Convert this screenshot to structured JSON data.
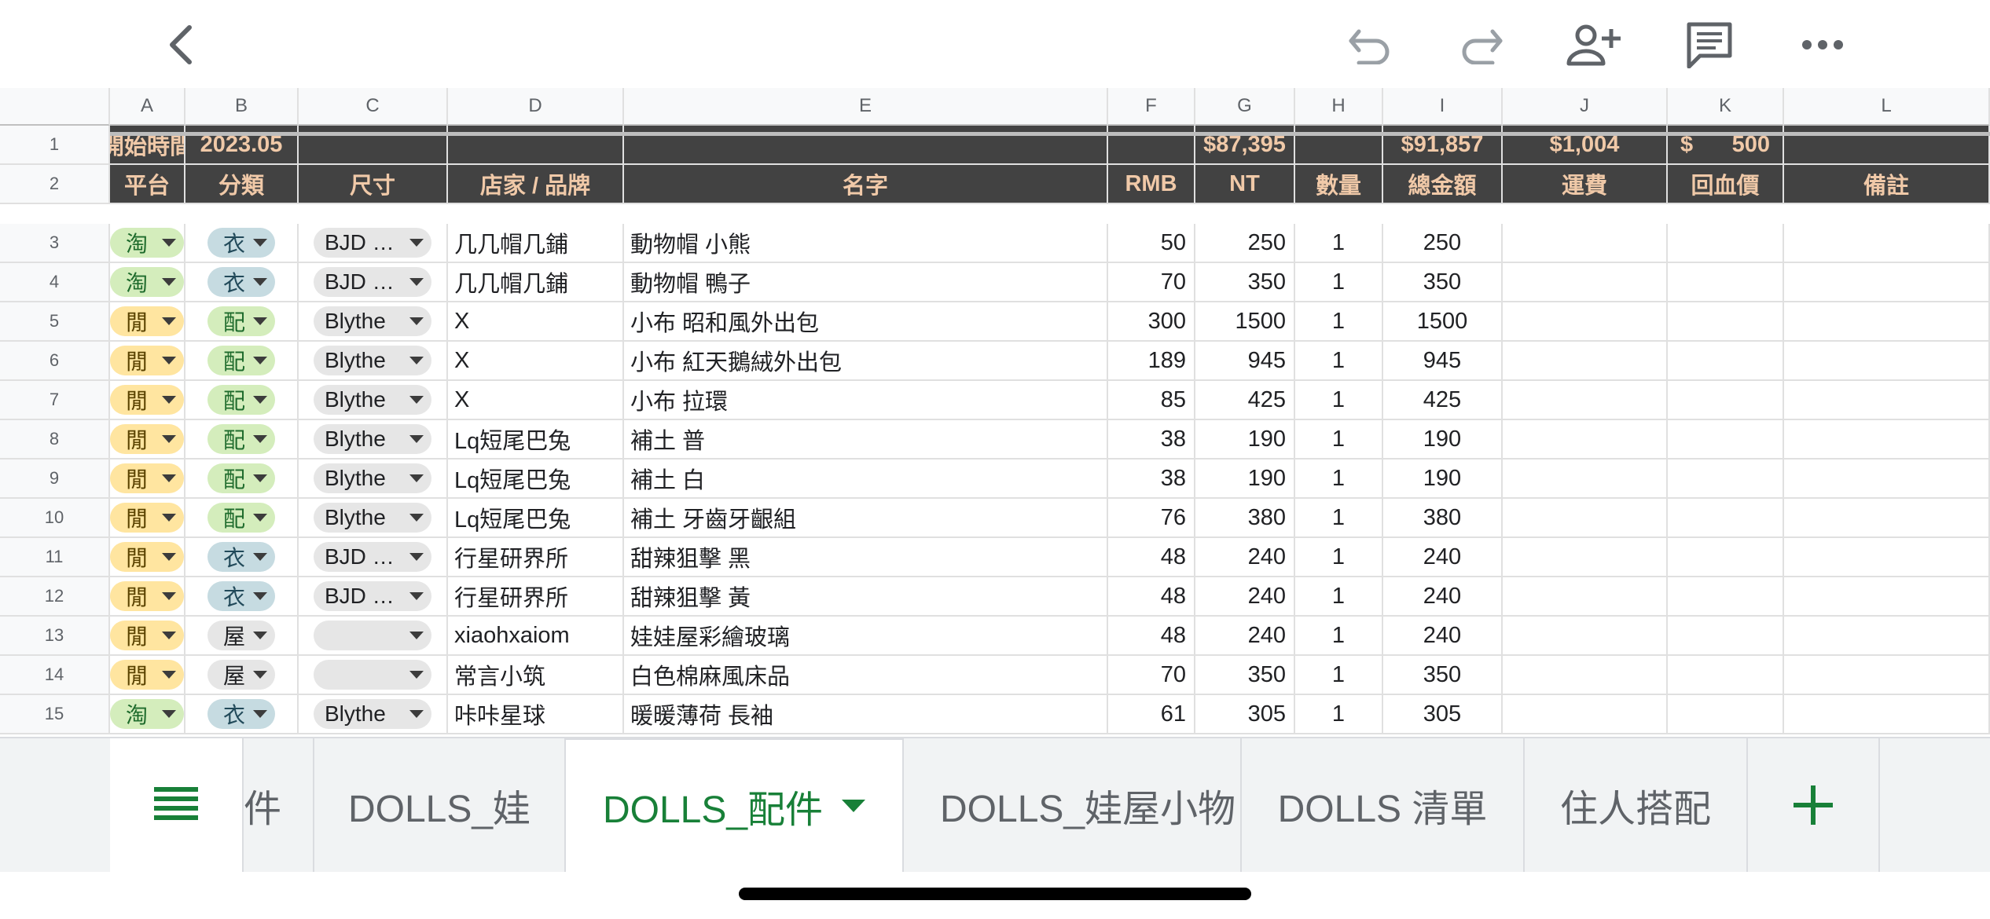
{
  "columns": [
    "A",
    "B",
    "C",
    "D",
    "E",
    "F",
    "G",
    "H",
    "I",
    "J",
    "K",
    "L"
  ],
  "row1": {
    "A": "開始時間",
    "B": "2023.05",
    "G": "$87,395",
    "I": "$91,857",
    "J": "$1,004",
    "K_symbol": "$",
    "K_value": "500"
  },
  "row2": {
    "A": "平台",
    "B": "分類",
    "C": "尺寸",
    "D": "店家 / 品牌",
    "E": "名字",
    "F": "RMB",
    "G": "NT",
    "H": "數量",
    "I": "總金額",
    "J": "運費",
    "K": "回血價",
    "L": "備註"
  },
  "rows": [
    {
      "n": "3",
      "platform": "淘",
      "category": "衣",
      "size": "BJD …",
      "shop": "几几帽几鋪",
      "name": "動物帽 小熊",
      "rmb": "50",
      "nt": "250",
      "qty": "1",
      "total": "250"
    },
    {
      "n": "4",
      "platform": "淘",
      "category": "衣",
      "size": "BJD …",
      "shop": "几几帽几鋪",
      "name": "動物帽 鴨子",
      "rmb": "70",
      "nt": "350",
      "qty": "1",
      "total": "350"
    },
    {
      "n": "5",
      "platform": "閒",
      "category": "配",
      "size": "Blythe",
      "shop": "X",
      "name": "小布 昭和風外出包",
      "rmb": "300",
      "nt": "1500",
      "qty": "1",
      "total": "1500"
    },
    {
      "n": "6",
      "platform": "閒",
      "category": "配",
      "size": "Blythe",
      "shop": "X",
      "name": "小布 紅天鵝絨外出包",
      "rmb": "189",
      "nt": "945",
      "qty": "1",
      "total": "945"
    },
    {
      "n": "7",
      "platform": "閒",
      "category": "配",
      "size": "Blythe",
      "shop": "X",
      "name": "小布 拉環",
      "rmb": "85",
      "nt": "425",
      "qty": "1",
      "total": "425"
    },
    {
      "n": "8",
      "platform": "閒",
      "category": "配",
      "size": "Blythe",
      "shop": "Lq短尾巴兔",
      "name": "補土 普",
      "rmb": "38",
      "nt": "190",
      "qty": "1",
      "total": "190"
    },
    {
      "n": "9",
      "platform": "閒",
      "category": "配",
      "size": "Blythe",
      "shop": "Lq短尾巴兔",
      "name": "補土 白",
      "rmb": "38",
      "nt": "190",
      "qty": "1",
      "total": "190"
    },
    {
      "n": "10",
      "platform": "閒",
      "category": "配",
      "size": "Blythe",
      "shop": "Lq短尾巴兔",
      "name": "補土 牙齒牙齦組",
      "rmb": "76",
      "nt": "380",
      "qty": "1",
      "total": "380"
    },
    {
      "n": "11",
      "platform": "閒",
      "category": "衣",
      "size": "BJD …",
      "shop": "行星研界所",
      "name": "甜辣狙擊 黑",
      "rmb": "48",
      "nt": "240",
      "qty": "1",
      "total": "240"
    },
    {
      "n": "12",
      "platform": "閒",
      "category": "衣",
      "size": "BJD …",
      "shop": "行星研界所",
      "name": "甜辣狙擊 黃",
      "rmb": "48",
      "nt": "240",
      "qty": "1",
      "total": "240"
    },
    {
      "n": "13",
      "platform": "閒",
      "category": "屋",
      "size": "",
      "shop": "xiaohxaiom",
      "name": "娃娃屋彩繪玻璃",
      "rmb": "48",
      "nt": "240",
      "qty": "1",
      "total": "240"
    },
    {
      "n": "14",
      "platform": "閒",
      "category": "屋",
      "size": "",
      "shop": "常言小筑",
      "name": "白色棉麻風床品",
      "rmb": "70",
      "nt": "350",
      "qty": "1",
      "total": "350"
    },
    {
      "n": "15",
      "platform": "淘",
      "category": "衣",
      "size": "Blythe",
      "shop": "咔咔星球",
      "name": "暖暖薄荷 長袖",
      "rmb": "61",
      "nt": "305",
      "qty": "1",
      "total": "305"
    }
  ],
  "tabs": [
    "件",
    "DOLLS_娃",
    "DOLLS_配件",
    "DOLLS_娃屋小物",
    "DOLLS 清單",
    "住人搭配"
  ],
  "active_tab": "DOLLS_配件",
  "chip_colors": {
    "淘": "green",
    "閒": "yellow",
    "衣": "blue",
    "配": "green",
    "屋": "gray"
  },
  "icons": [
    "back-arrow-icon",
    "undo-icon",
    "redo-icon",
    "add-person-icon",
    "comment-icon",
    "more-icon",
    "sheets-menu-icon",
    "add-sheet-icon",
    "dropdown-arrow-icon"
  ]
}
